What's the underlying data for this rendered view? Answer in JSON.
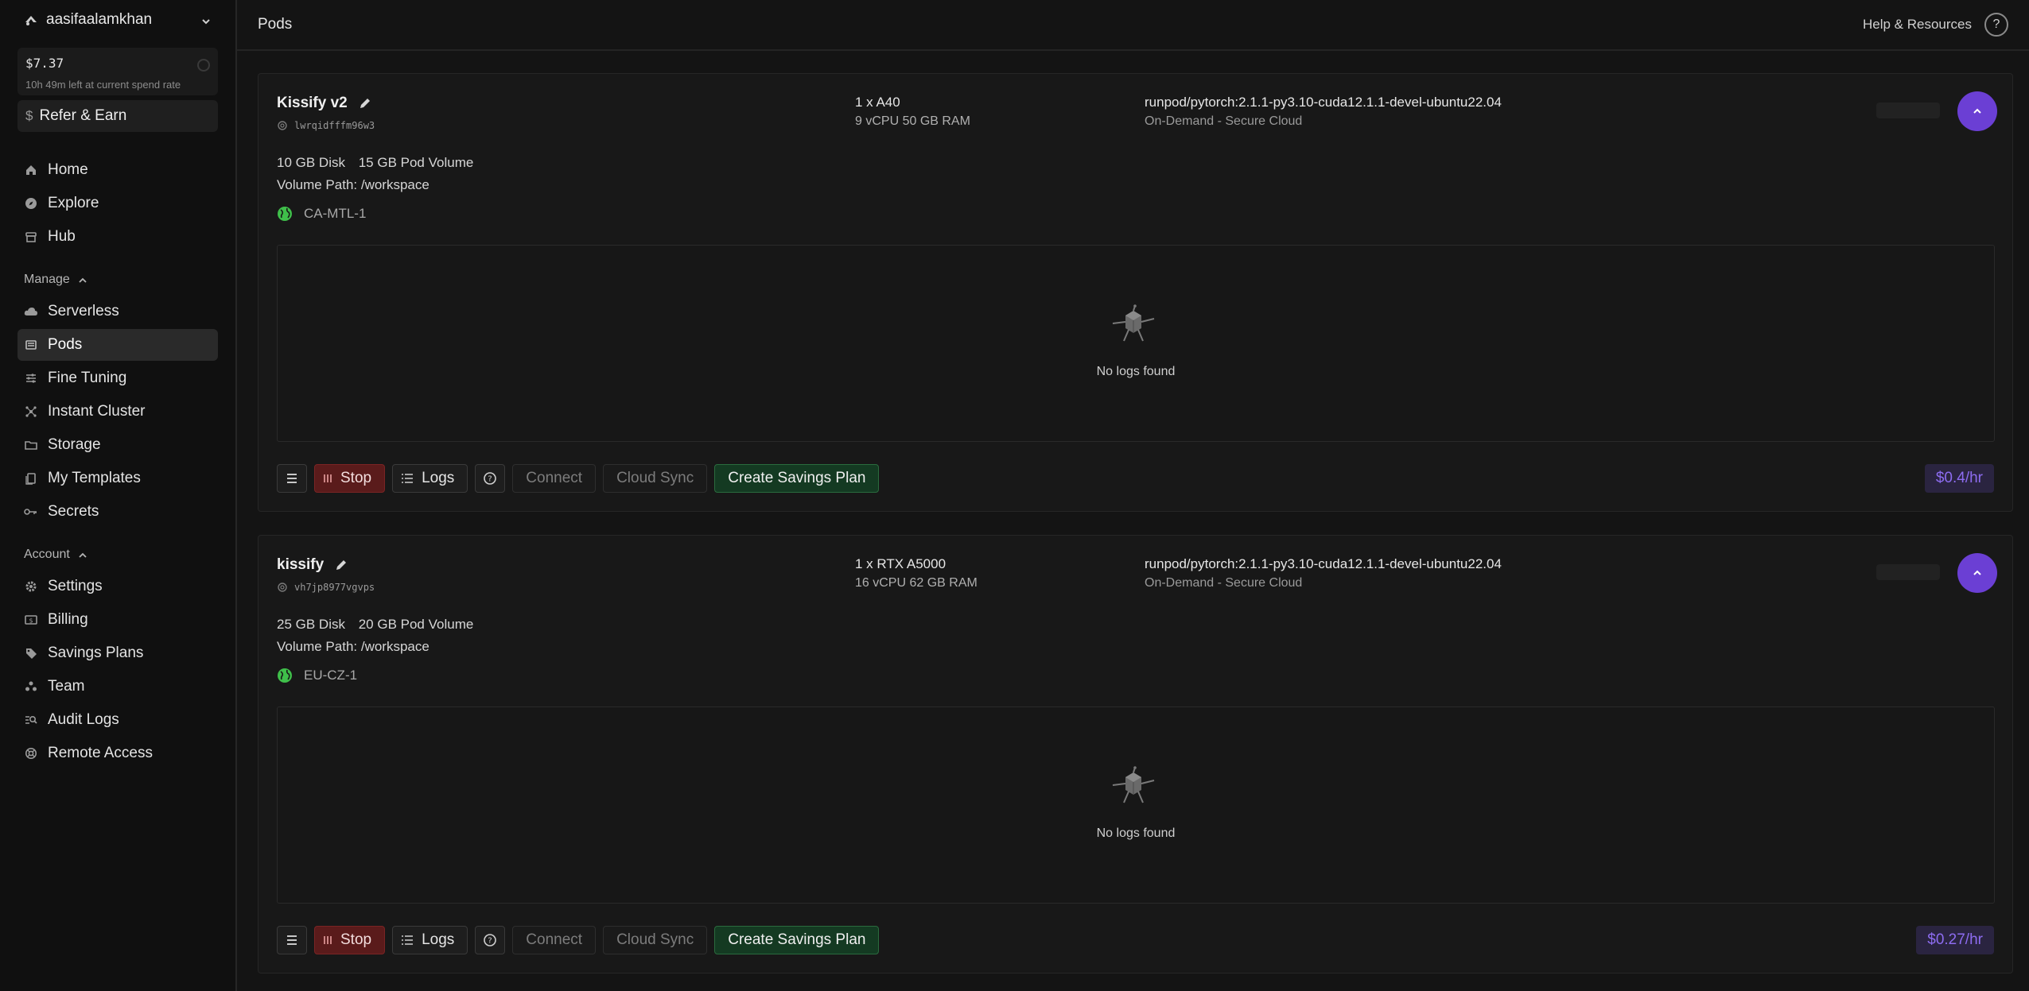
{
  "account": {
    "username": "aasifaalamkhan"
  },
  "balance": {
    "amount": "$7.37",
    "time_left": "10h 49m left at current spend rate"
  },
  "refer": {
    "label": "Refer & Earn"
  },
  "nav_main": [
    {
      "label": "Home",
      "icon": "home-icon"
    },
    {
      "label": "Explore",
      "icon": "compass-icon"
    },
    {
      "label": "Hub",
      "icon": "store-icon"
    }
  ],
  "sections": {
    "manage": "Manage",
    "account": "Account"
  },
  "nav_manage": [
    {
      "label": "Serverless",
      "icon": "cloud-icon"
    },
    {
      "label": "Pods",
      "icon": "pods-icon"
    },
    {
      "label": "Fine Tuning",
      "icon": "sliders-icon"
    },
    {
      "label": "Instant Cluster",
      "icon": "cluster-icon"
    },
    {
      "label": "Storage",
      "icon": "folder-icon"
    },
    {
      "label": "My Templates",
      "icon": "templates-icon"
    },
    {
      "label": "Secrets",
      "icon": "key-icon"
    }
  ],
  "nav_account": [
    {
      "label": "Settings",
      "icon": "gear-icon"
    },
    {
      "label": "Billing",
      "icon": "billing-icon"
    },
    {
      "label": "Savings Plans",
      "icon": "tag-icon"
    },
    {
      "label": "Team",
      "icon": "team-icon"
    },
    {
      "label": "Audit Logs",
      "icon": "audit-icon"
    },
    {
      "label": "Remote Access",
      "icon": "lifebuoy-icon"
    }
  ],
  "topbar": {
    "title": "Pods",
    "help": "Help & Resources"
  },
  "pods": [
    {
      "name": "Kissify v2",
      "id": "lwrqidfffm96w3",
      "gpu": "1 x A40",
      "specs": "9 vCPU 50 GB RAM",
      "image": "runpod/pytorch:2.1.1-py3.10-cuda12.1.1-devel-ubuntu22.04",
      "cloud": "On-Demand - Secure Cloud",
      "disk": "10 GB Disk",
      "volume": "15 GB Pod Volume",
      "volume_path": "Volume Path: /workspace",
      "region": "CA-MTL-1",
      "logs_empty": "No logs found",
      "price": "$0.4/hr"
    },
    {
      "name": "kissify",
      "id": "vh7jp8977vgvps",
      "gpu": "1 x RTX A5000",
      "specs": "16 vCPU 62 GB RAM",
      "image": "runpod/pytorch:2.1.1-py3.10-cuda12.1.1-devel-ubuntu22.04",
      "cloud": "On-Demand - Secure Cloud",
      "disk": "25 GB Disk",
      "volume": "20 GB Pod Volume",
      "volume_path": "Volume Path: /workspace",
      "region": "EU-CZ-1",
      "logs_empty": "No logs found",
      "price": "$0.27/hr"
    }
  ],
  "actions": {
    "stop": "Stop",
    "logs": "Logs",
    "connect": "Connect",
    "cloud_sync": "Cloud Sync",
    "savings": "Create Savings Plan"
  },
  "colors": {
    "accent": "#6b3fd4",
    "stop": "#5a1b1b",
    "savings": "#143a22",
    "region_ok": "#3fbf4a"
  }
}
